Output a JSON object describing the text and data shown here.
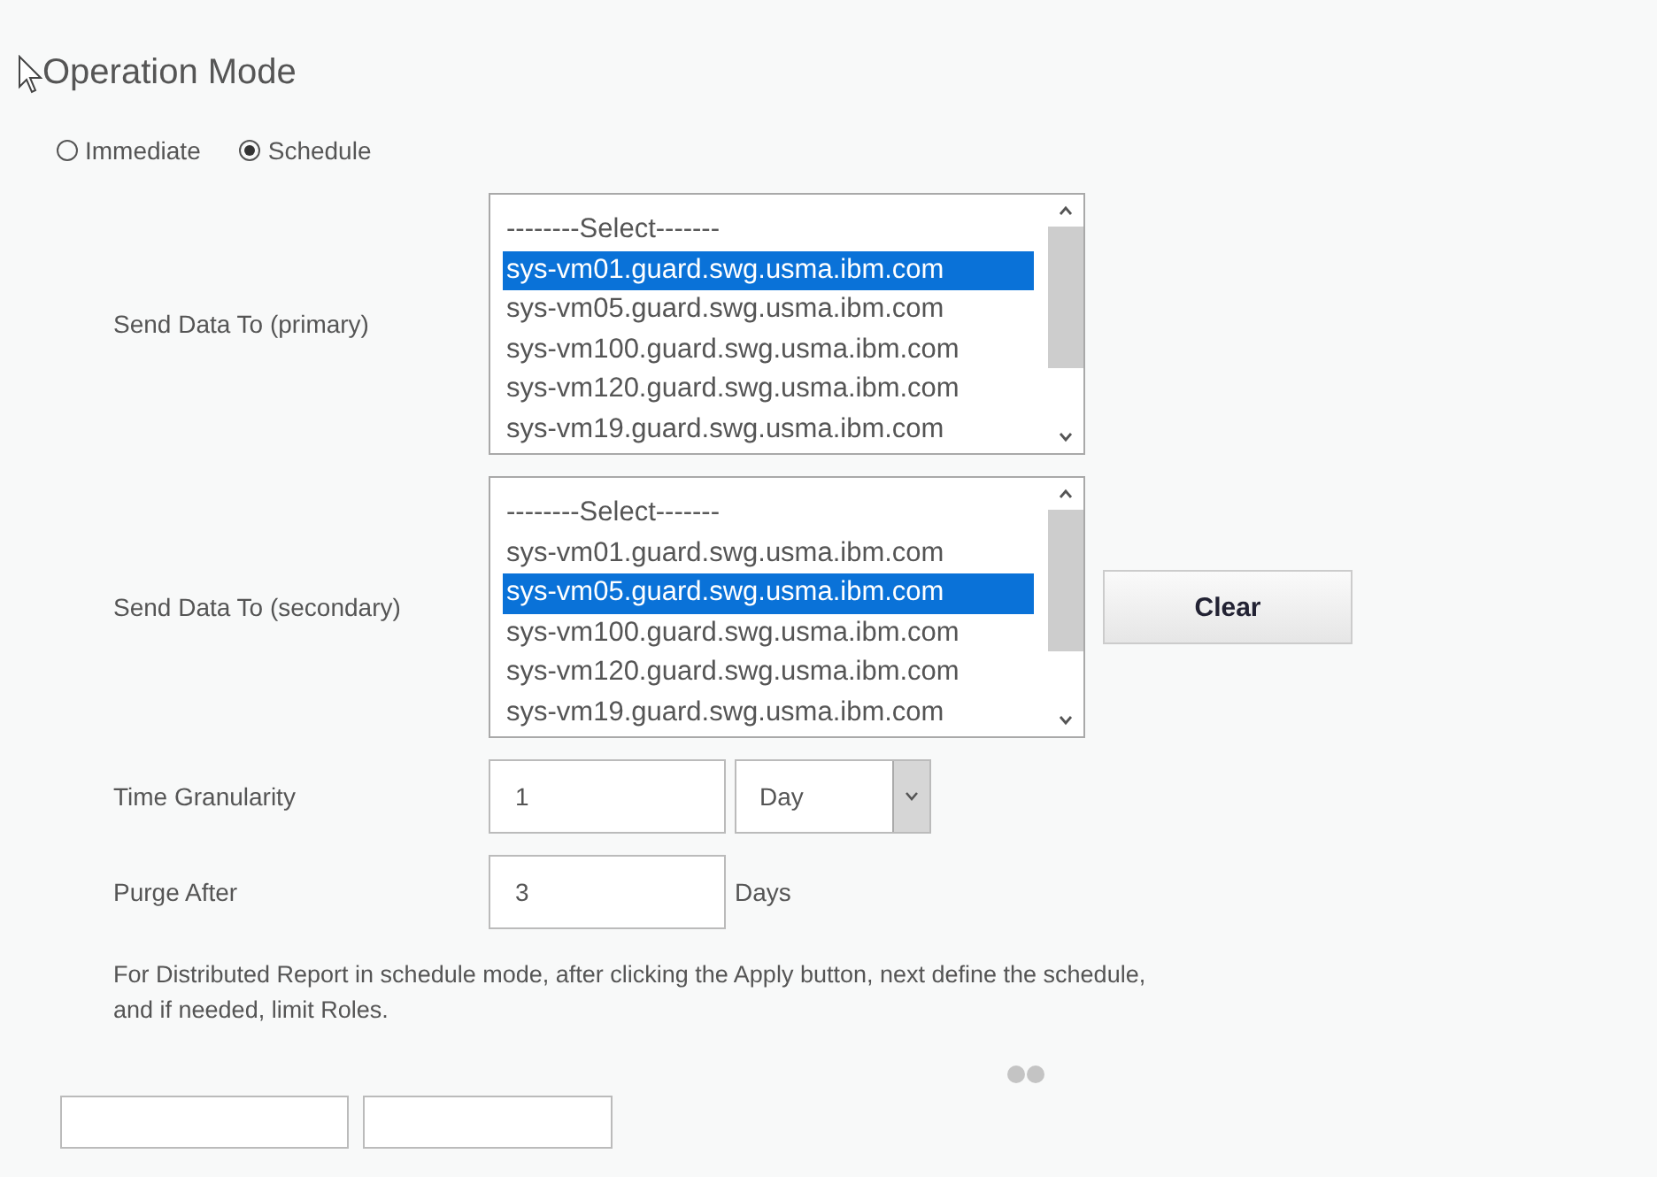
{
  "heading": "Operation Mode",
  "modes": [
    {
      "label": "Immediate",
      "selected": false
    },
    {
      "label": "Schedule",
      "selected": true
    }
  ],
  "targets": [
    {
      "label": "Send Data To (primary)",
      "options": [
        {
          "text": "--------Select-------",
          "selected": false
        },
        {
          "text": "sys-vm01.guard.swg.usma.ibm.com",
          "selected": true
        },
        {
          "text": "sys-vm05.guard.swg.usma.ibm.com",
          "selected": false
        },
        {
          "text": "sys-vm100.guard.swg.usma.ibm.com",
          "selected": false
        },
        {
          "text": "sys-vm120.guard.swg.usma.ibm.com",
          "selected": false
        },
        {
          "text": "sys-vm19.guard.swg.usma.ibm.com",
          "selected": false
        }
      ]
    },
    {
      "label": "Send Data To (secondary)",
      "options": [
        {
          "text": "--------Select-------",
          "selected": false
        },
        {
          "text": "sys-vm01.guard.swg.usma.ibm.com",
          "selected": false
        },
        {
          "text": "sys-vm05.guard.swg.usma.ibm.com",
          "selected": true
        },
        {
          "text": "sys-vm100.guard.swg.usma.ibm.com",
          "selected": false
        },
        {
          "text": "sys-vm120.guard.swg.usma.ibm.com",
          "selected": false
        },
        {
          "text": "sys-vm19.guard.swg.usma.ibm.com",
          "selected": false
        }
      ],
      "button": "Clear"
    }
  ],
  "time_granularity": {
    "label": "Time Granularity",
    "value": "1",
    "unit": "Day"
  },
  "purge_after": {
    "label": "Purge After",
    "value": "3",
    "unit": "Days"
  },
  "note": "For Distributed Report in schedule mode, after clicking the Apply button, next define the schedule, and if needed, limit Roles."
}
